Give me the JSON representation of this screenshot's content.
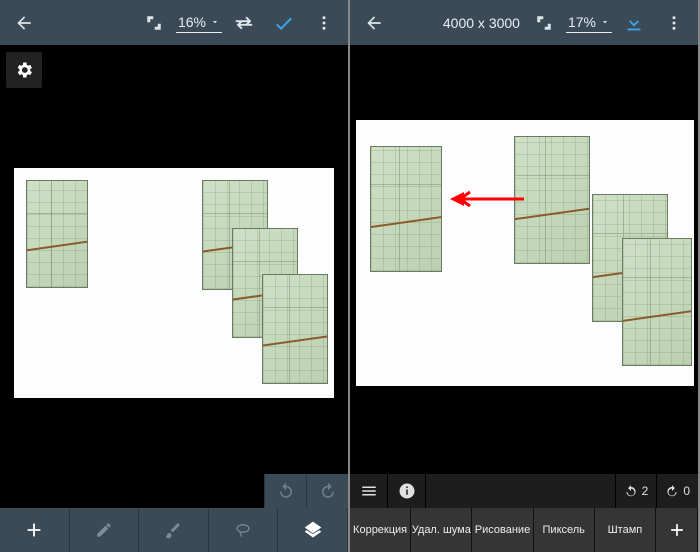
{
  "left": {
    "zoom": "16%",
    "topbar_icons": [
      "back",
      "crop",
      "zoom",
      "swap",
      "check",
      "more"
    ],
    "bottom_row1": [
      "undo",
      "redo"
    ],
    "bottom_row2": [
      "add",
      "edit",
      "brush",
      "lasso",
      "layers"
    ]
  },
  "right": {
    "dimensions": "4000 x 3000",
    "zoom": "17%",
    "topbar_icons": [
      "back",
      "dimensions",
      "crop",
      "zoom",
      "download",
      "more"
    ],
    "row1": {
      "menu": "menu",
      "info": "info",
      "undo_count": "2",
      "redo_count": "0"
    },
    "tools": [
      "Коррекция",
      "Удал. шума",
      "Рисование",
      "Пиксель",
      "Штамп"
    ],
    "plus": "+"
  }
}
